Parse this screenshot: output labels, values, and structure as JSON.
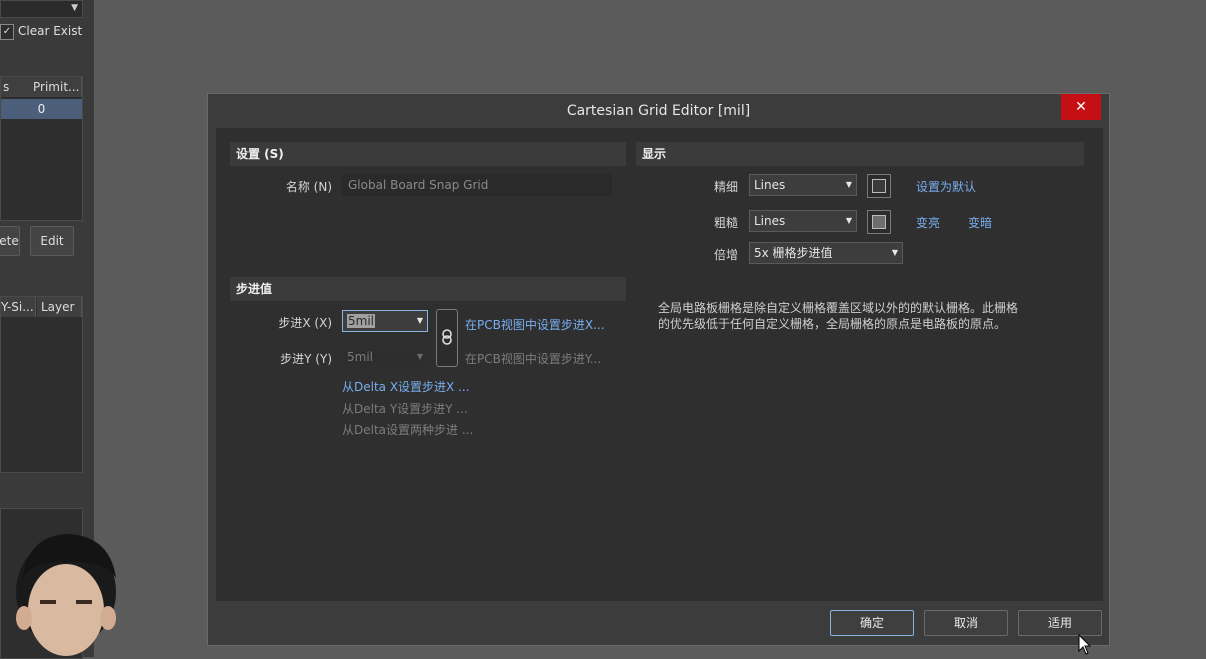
{
  "background_panel": {
    "clear_existing_label": "Clear Exist",
    "table_headers": [
      "s",
      "Primit..."
    ],
    "table_row_value": "0",
    "buttons": [
      "ete",
      "Edit"
    ],
    "table2_headers": [
      "Y-Si...",
      "Layer"
    ]
  },
  "dialog": {
    "title": "Cartesian Grid Editor [mil]",
    "close_symbol": "✕",
    "settings_section": {
      "header": "设置 (S)",
      "name_label": "名称 (N)",
      "name_value": "Global Board Snap Grid"
    },
    "step_section": {
      "header": "步进值",
      "step_x_label": "步进X (X)",
      "step_x_value": "5mil",
      "step_y_label": "步进Y (Y)",
      "step_y_value": "5mil",
      "set_x_from_pcb": "在PCB视图中设置步进X...",
      "set_y_from_pcb": "在PCB视图中设置步进Y...",
      "set_x_from_delta": "从Delta X设置步进X ...",
      "set_y_from_delta": "从Delta Y设置步进Y ...",
      "set_both_from_delta": "从Delta设置两种步进 ..."
    },
    "display_section": {
      "header": "显示",
      "fine_label": "精细",
      "fine_value": "Lines",
      "coarse_label": "粗糙",
      "coarse_value": "Lines",
      "multiplier_label": "倍增",
      "multiplier_value": "5x 栅格步进值",
      "set_default_link": "设置为默认",
      "lighten_link": "变亮",
      "darken_link": "变暗",
      "fine_color": "#3a3a3a",
      "coarse_color": "#6e6e6e",
      "description_line1": "全局电路板栅格是除自定义栅格覆盖区域以外的的默认栅格。此栅格",
      "description_line2": "的优先级低于任何自定义栅格，全局栅格的原点是电路板的原点。"
    },
    "footer": {
      "ok": "确定",
      "cancel": "取消",
      "apply": "适用"
    }
  }
}
